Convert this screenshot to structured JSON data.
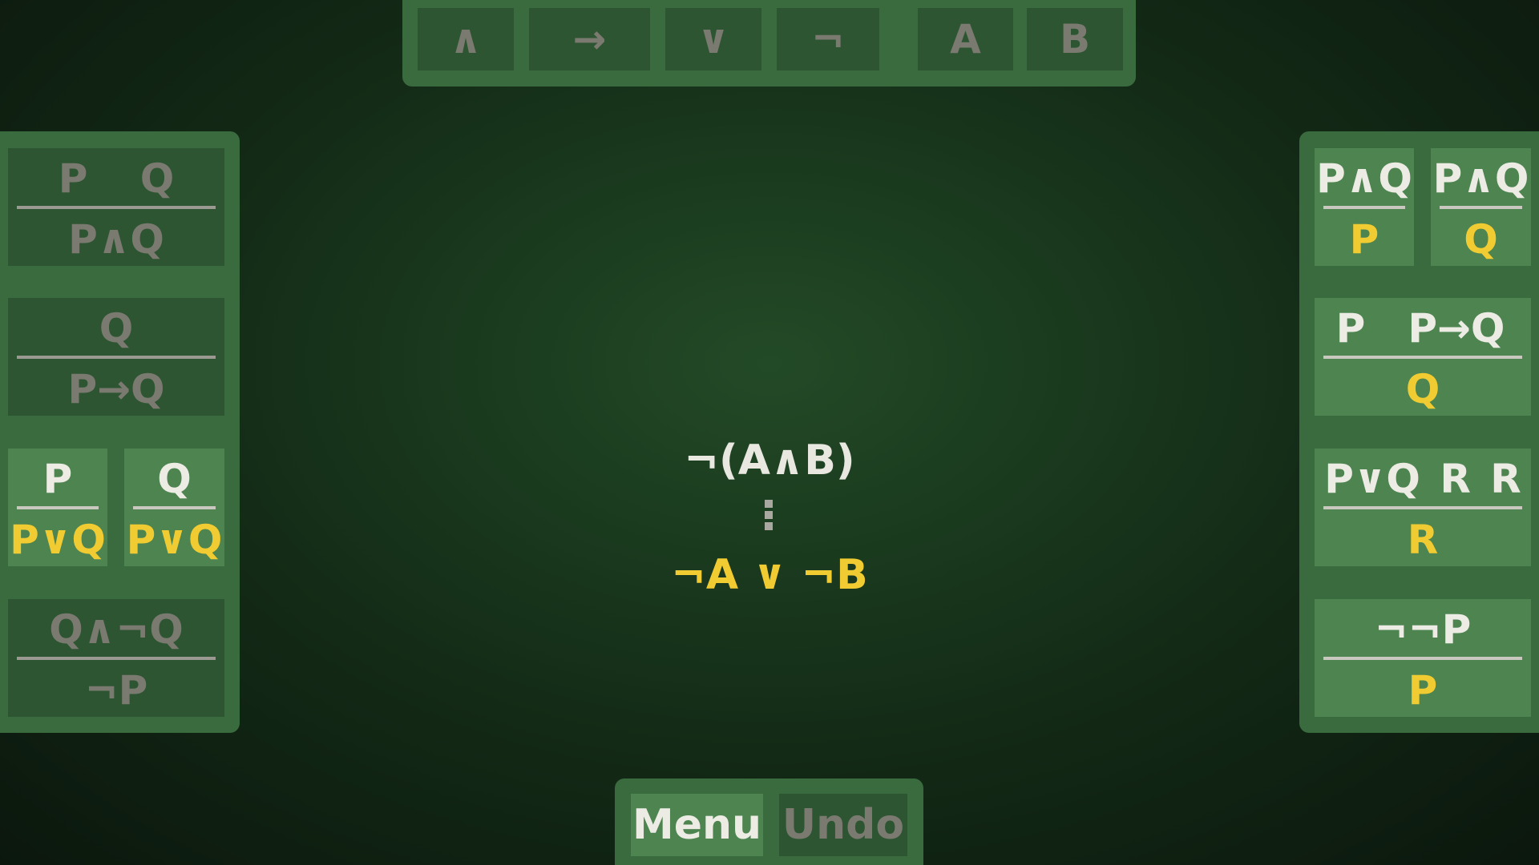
{
  "toolbar": {
    "symbols": [
      "∧",
      "→",
      "∨",
      "¬",
      "A",
      "B"
    ]
  },
  "left_rules": [
    {
      "premises": [
        "P",
        "Q"
      ],
      "conclusion": "P∧Q"
    },
    {
      "premises": [
        "Q"
      ],
      "conclusion": "P→Q"
    },
    {
      "premises": [
        "P"
      ],
      "conclusion": "P∨Q"
    },
    {
      "premises": [
        "Q"
      ],
      "conclusion": "P∨Q"
    },
    {
      "premises": [
        "Q∧¬Q"
      ],
      "conclusion": "¬P"
    }
  ],
  "right_rules": [
    {
      "premises": [
        "P∧Q"
      ],
      "conclusion": "P"
    },
    {
      "premises": [
        "P∧Q"
      ],
      "conclusion": "Q"
    },
    {
      "premises": [
        "P",
        "P→Q"
      ],
      "conclusion": "Q"
    },
    {
      "premises": [
        "P∨Q",
        "R",
        "R"
      ],
      "conclusion": "R"
    },
    {
      "premises": [
        "¬¬P"
      ],
      "conclusion": "P"
    }
  ],
  "goal": {
    "premise": "¬(A∧B)",
    "target": "¬A ∨ ¬B"
  },
  "controls": {
    "menu_label": "Menu",
    "undo_label": "Undo"
  },
  "colors": {
    "panel": "#3a6b3e",
    "tile_inactive": "#2e5532",
    "tile_active": "#4d8450",
    "highlight": "#f0cb32"
  }
}
